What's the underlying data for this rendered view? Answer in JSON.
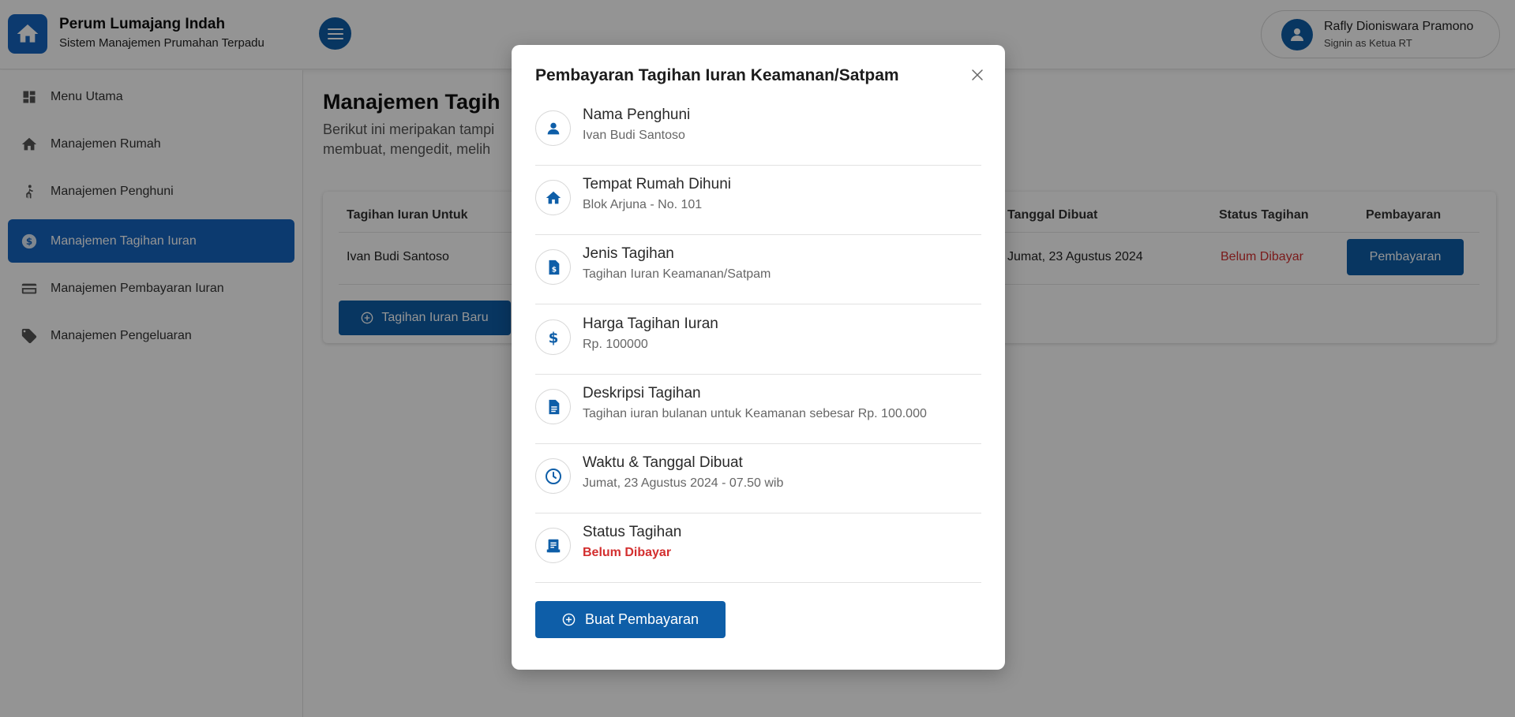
{
  "header": {
    "app_title": "Perum Lumajang Indah",
    "app_subtitle": "Sistem Manajemen Prumahan Terpadu",
    "user_name": "Rafly Dioniswara Pramono",
    "user_role": "Signin as Ketua RT"
  },
  "sidebar": {
    "items": [
      {
        "label": "Menu Utama",
        "icon": "dashboard-icon"
      },
      {
        "label": "Manajemen Rumah",
        "icon": "home-icon"
      },
      {
        "label": "Manajemen Penghuni",
        "icon": "person-icon"
      },
      {
        "label": "Manajemen Tagihan Iuran",
        "icon": "dollar-circle-icon",
        "active": true
      },
      {
        "label": "Manajemen Pembayaran Iuran",
        "icon": "credit-card-icon"
      },
      {
        "label": "Manajemen Pengeluaran",
        "icon": "tag-icon"
      }
    ]
  },
  "main": {
    "title": "Manajemen Tagih",
    "description_line1": "Berikut ini meripakan tampi",
    "description_line2": "membuat, mengedit, melih",
    "table": {
      "headers": [
        "Tagihan Iuran Untuk",
        "Tanggal Dibuat",
        "Status Tagihan",
        "Pembayaran"
      ],
      "rows": [
        {
          "name": "Ivan Budi Santoso",
          "date": "Jumat, 23 Agustus 2024",
          "status": "Belum Dibayar",
          "action": "Pembayaran"
        }
      ]
    },
    "new_button": "Tagihan Iuran Baru"
  },
  "modal": {
    "title": "Pembayaran Tagihan Iuran Keamanan/Satpam",
    "fields": [
      {
        "label": "Nama Penghuni",
        "value": "Ivan Budi Santoso",
        "icon": "person-icon"
      },
      {
        "label": "Tempat Rumah Dihuni",
        "value": "Blok Arjuna - No. 101",
        "icon": "home-icon"
      },
      {
        "label": "Jenis Tagihan",
        "value": "Tagihan Iuran Keamanan/Satpam",
        "icon": "invoice-icon"
      },
      {
        "label": "Harga Tagihan Iuran",
        "value": "Rp. 100000",
        "icon": "dollar-icon"
      },
      {
        "label": "Deskripsi Tagihan",
        "value": "Tagihan iuran bulanan untuk Keamanan sebesar Rp. 100.000",
        "icon": "document-icon"
      },
      {
        "label": "Waktu & Tanggal Dibuat",
        "value": "Jumat, 23 Agustus 2024 - 07.50 wib",
        "icon": "clock-icon"
      },
      {
        "label": "Status Tagihan",
        "value": "Belum Dibayar",
        "icon": "receipt-icon"
      }
    ],
    "submit_label": "Buat Pembayaran"
  },
  "colors": {
    "primary": "#0e5ea8",
    "sidebar_active": "#1565c0",
    "status_unpaid": "#d32f2f"
  }
}
